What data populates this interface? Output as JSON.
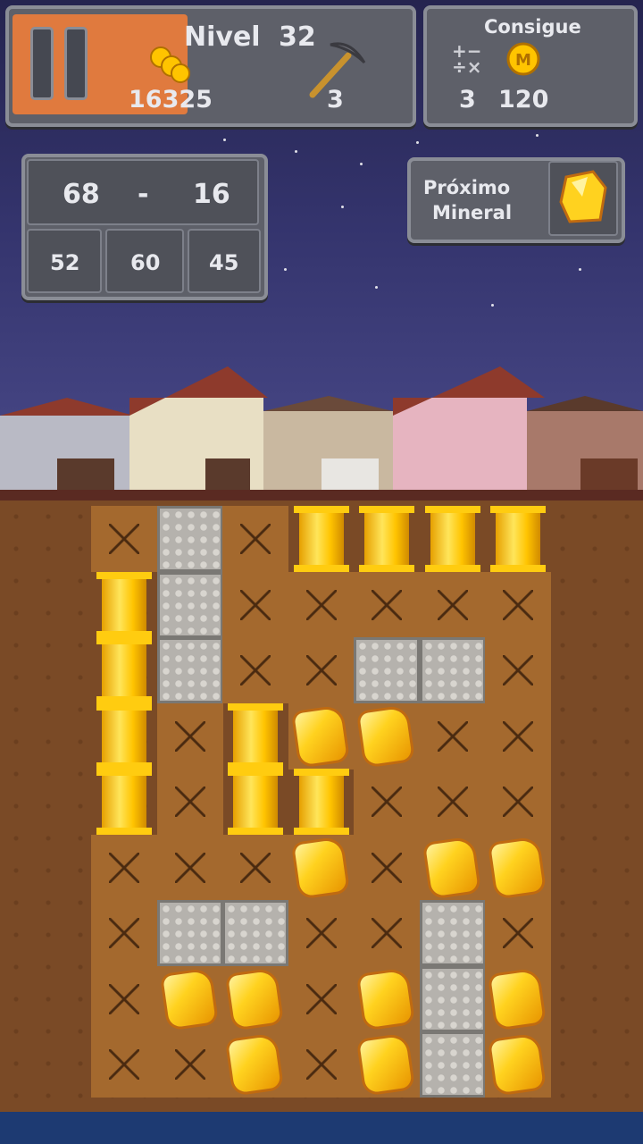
{
  "hud": {
    "level_label": "Nivel",
    "level_number": "32",
    "coins": "16325",
    "picks": "3"
  },
  "goal": {
    "title": "Consigue",
    "operations": "3",
    "coin_target": "120"
  },
  "target": {
    "left": "68",
    "operator": "-",
    "right": "16",
    "options": [
      "52",
      "60",
      "45"
    ]
  },
  "next_mineral": {
    "label_line1": "Próximo",
    "label_line2": "Mineral",
    "icon": "gold-nugget-icon"
  },
  "board": {
    "rows": [
      [
        "dirt",
        "stone",
        "dirt",
        "pipe",
        "pipe",
        "pipe",
        "pipe"
      ],
      [
        "pipe",
        "stone",
        "dirt",
        "dirt",
        "dirt",
        "dirt",
        "dirt"
      ],
      [
        "pipe",
        "stone",
        "dirt",
        "dirt",
        "stone",
        "stone",
        "dirt"
      ],
      [
        "pipe",
        "dirt",
        "pipe",
        "gem",
        "gem",
        "dirt",
        "dirt"
      ],
      [
        "pipe",
        "dirt",
        "pipe",
        "pipe",
        "dirt",
        "dirt",
        "dirt"
      ],
      [
        "dirt",
        "dirt",
        "dirt",
        "gem",
        "dirt",
        "gem",
        "gem"
      ],
      [
        "dirt",
        "stone",
        "stone",
        "dirt",
        "dirt",
        "stone",
        "dirt"
      ],
      [
        "dirt",
        "gem",
        "gem",
        "dirt",
        "gem",
        "stone",
        "gem"
      ],
      [
        "dirt",
        "dirt",
        "gem",
        "dirt",
        "gem",
        "stone",
        "gem"
      ]
    ]
  },
  "colors": {
    "accent": "#e07a3e",
    "gold": "#ffd21f",
    "panel": "#5e6069"
  }
}
